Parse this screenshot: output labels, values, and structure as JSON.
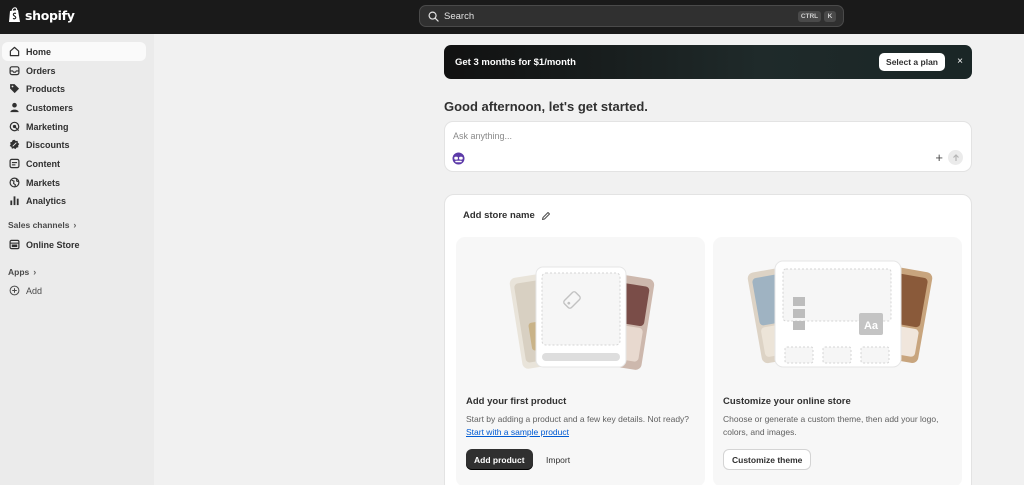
{
  "topbar": {
    "logo_text": "shopify",
    "search_placeholder": "Search",
    "shortcut_keys": [
      "CTRL",
      "K"
    ]
  },
  "sidebar": {
    "items": [
      {
        "label": "Home",
        "icon": "home-icon",
        "active": true
      },
      {
        "label": "Orders",
        "icon": "inbox-icon"
      },
      {
        "label": "Products",
        "icon": "tag-icon"
      },
      {
        "label": "Customers",
        "icon": "person-icon"
      },
      {
        "label": "Marketing",
        "icon": "target-icon"
      },
      {
        "label": "Discounts",
        "icon": "discount-icon"
      },
      {
        "label": "Content",
        "icon": "content-icon"
      },
      {
        "label": "Markets",
        "icon": "globe-icon"
      },
      {
        "label": "Analytics",
        "icon": "bar-chart-icon"
      }
    ],
    "sales_channels_label": "Sales channels",
    "online_store_label": "Online Store",
    "apps_label": "Apps",
    "add_label": "Add"
  },
  "banner": {
    "text": "Get 3 months for $1/month",
    "button_label": "Select a plan",
    "close_symbol": "×"
  },
  "greeting": "Good afternoon, let's get started.",
  "ask": {
    "placeholder": "Ask anything..."
  },
  "store_card": {
    "title": "Add store name",
    "tiles": [
      {
        "title": "Add your first product",
        "desc_prefix": "Start by adding a product and a few key details. Not ready? ",
        "link": "Start with a sample product",
        "primary_button": "Add product",
        "secondary_button": "Import"
      },
      {
        "title": "Customize your online store",
        "desc": "Choose or generate a custom theme, then add your logo, colors, and images.",
        "button": "Customize theme",
        "illus_text": "Aa"
      }
    ]
  },
  "colors": {
    "topbar_bg": "#1a1a1a",
    "sidebar_bg": "#ebebeb",
    "page_bg": "#f1f1f1",
    "primary_button": "#303030",
    "link": "#005bd3"
  }
}
